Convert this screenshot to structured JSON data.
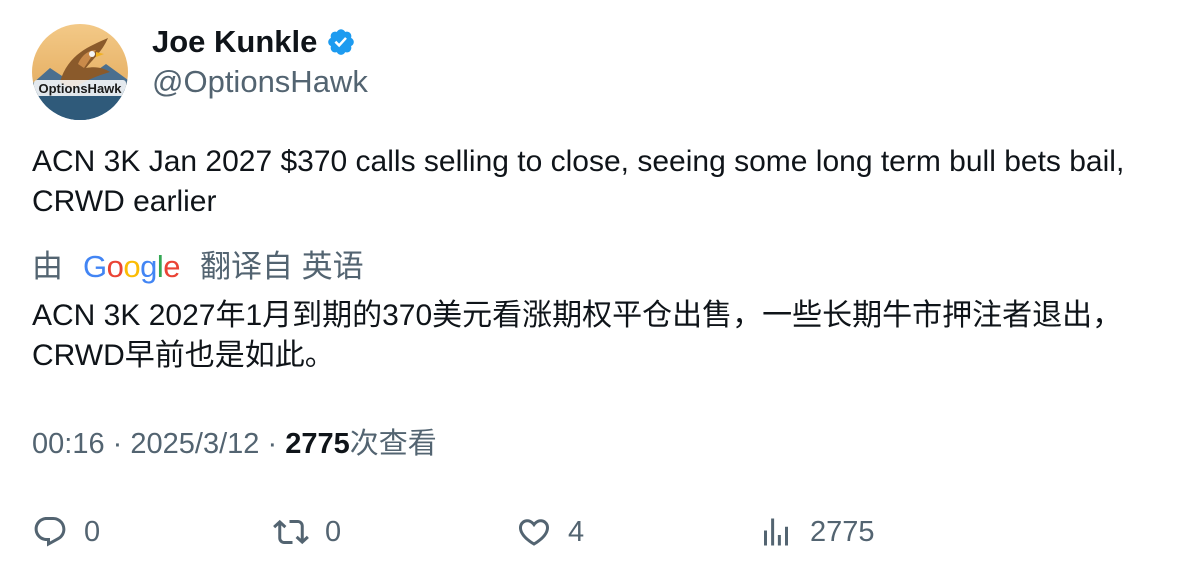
{
  "author": {
    "display_name": "Joe Kunkle",
    "handle": "@OptionsHawk",
    "avatar_text": "OptionsHawk",
    "verified": true,
    "verified_color": "#1d9bf0"
  },
  "tweet": {
    "text": "ACN 3K Jan 2027 $370 calls selling to close, seeing some long term bull bets bail, CRWD earlier",
    "translation": {
      "prefix": "由",
      "provider": "Google",
      "suffix": "翻译自 英语",
      "text": "ACN 3K 2027年1月到期的370美元看涨期权平仓出售，一些长期牛市押注者退出，CRWD早前也是如此。"
    }
  },
  "meta": {
    "time": "00:16",
    "separator": "·",
    "date": "2025/3/12",
    "views_count": "2775",
    "views_label": "次查看"
  },
  "actions": {
    "reply_count": "0",
    "retweet_count": "0",
    "like_count": "4",
    "views_count": "2775"
  },
  "colors": {
    "text_primary": "#0f1419",
    "text_secondary": "#536471"
  }
}
